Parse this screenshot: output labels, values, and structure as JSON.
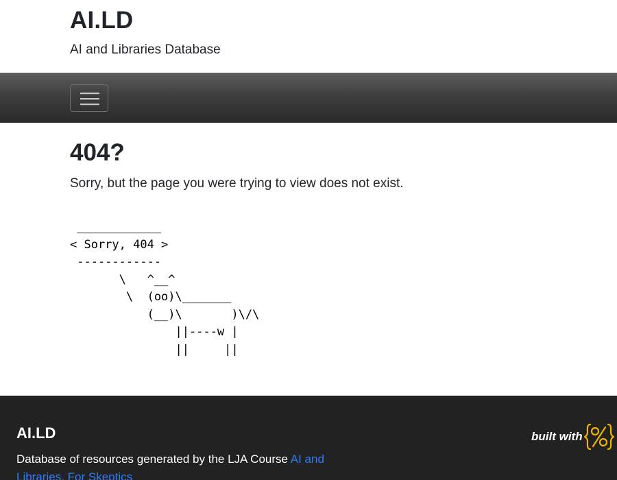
{
  "header": {
    "title": "AI.LD",
    "subtitle": "AI and Libraries Database"
  },
  "navbar": {
    "toggle_icon": "hamburger-menu-icon"
  },
  "main": {
    "heading": "404?",
    "message": "Sorry, but the page you were trying to view does not exist.",
    "ascii_art": " ____________\n< Sorry, 404 >\n ------------\n       \\   ^__^\n        \\  (oo)\\_______\n           (__)\\       )\\/\\\n               ||----w |\n               ||     ||"
  },
  "footer": {
    "title": "AI.LD",
    "description_prefix": "Database of resources generated by the LJA Course ",
    "course_link": "AI and Libraries, For Skeptics",
    "built_with_label": "built with",
    "built_with_logo": "curly-percent-logo-icon",
    "logo_color": "#f2b400"
  },
  "colors": {
    "navbar": "#3e3e3e",
    "footer": "#222222",
    "link": "#2f7cf6"
  }
}
